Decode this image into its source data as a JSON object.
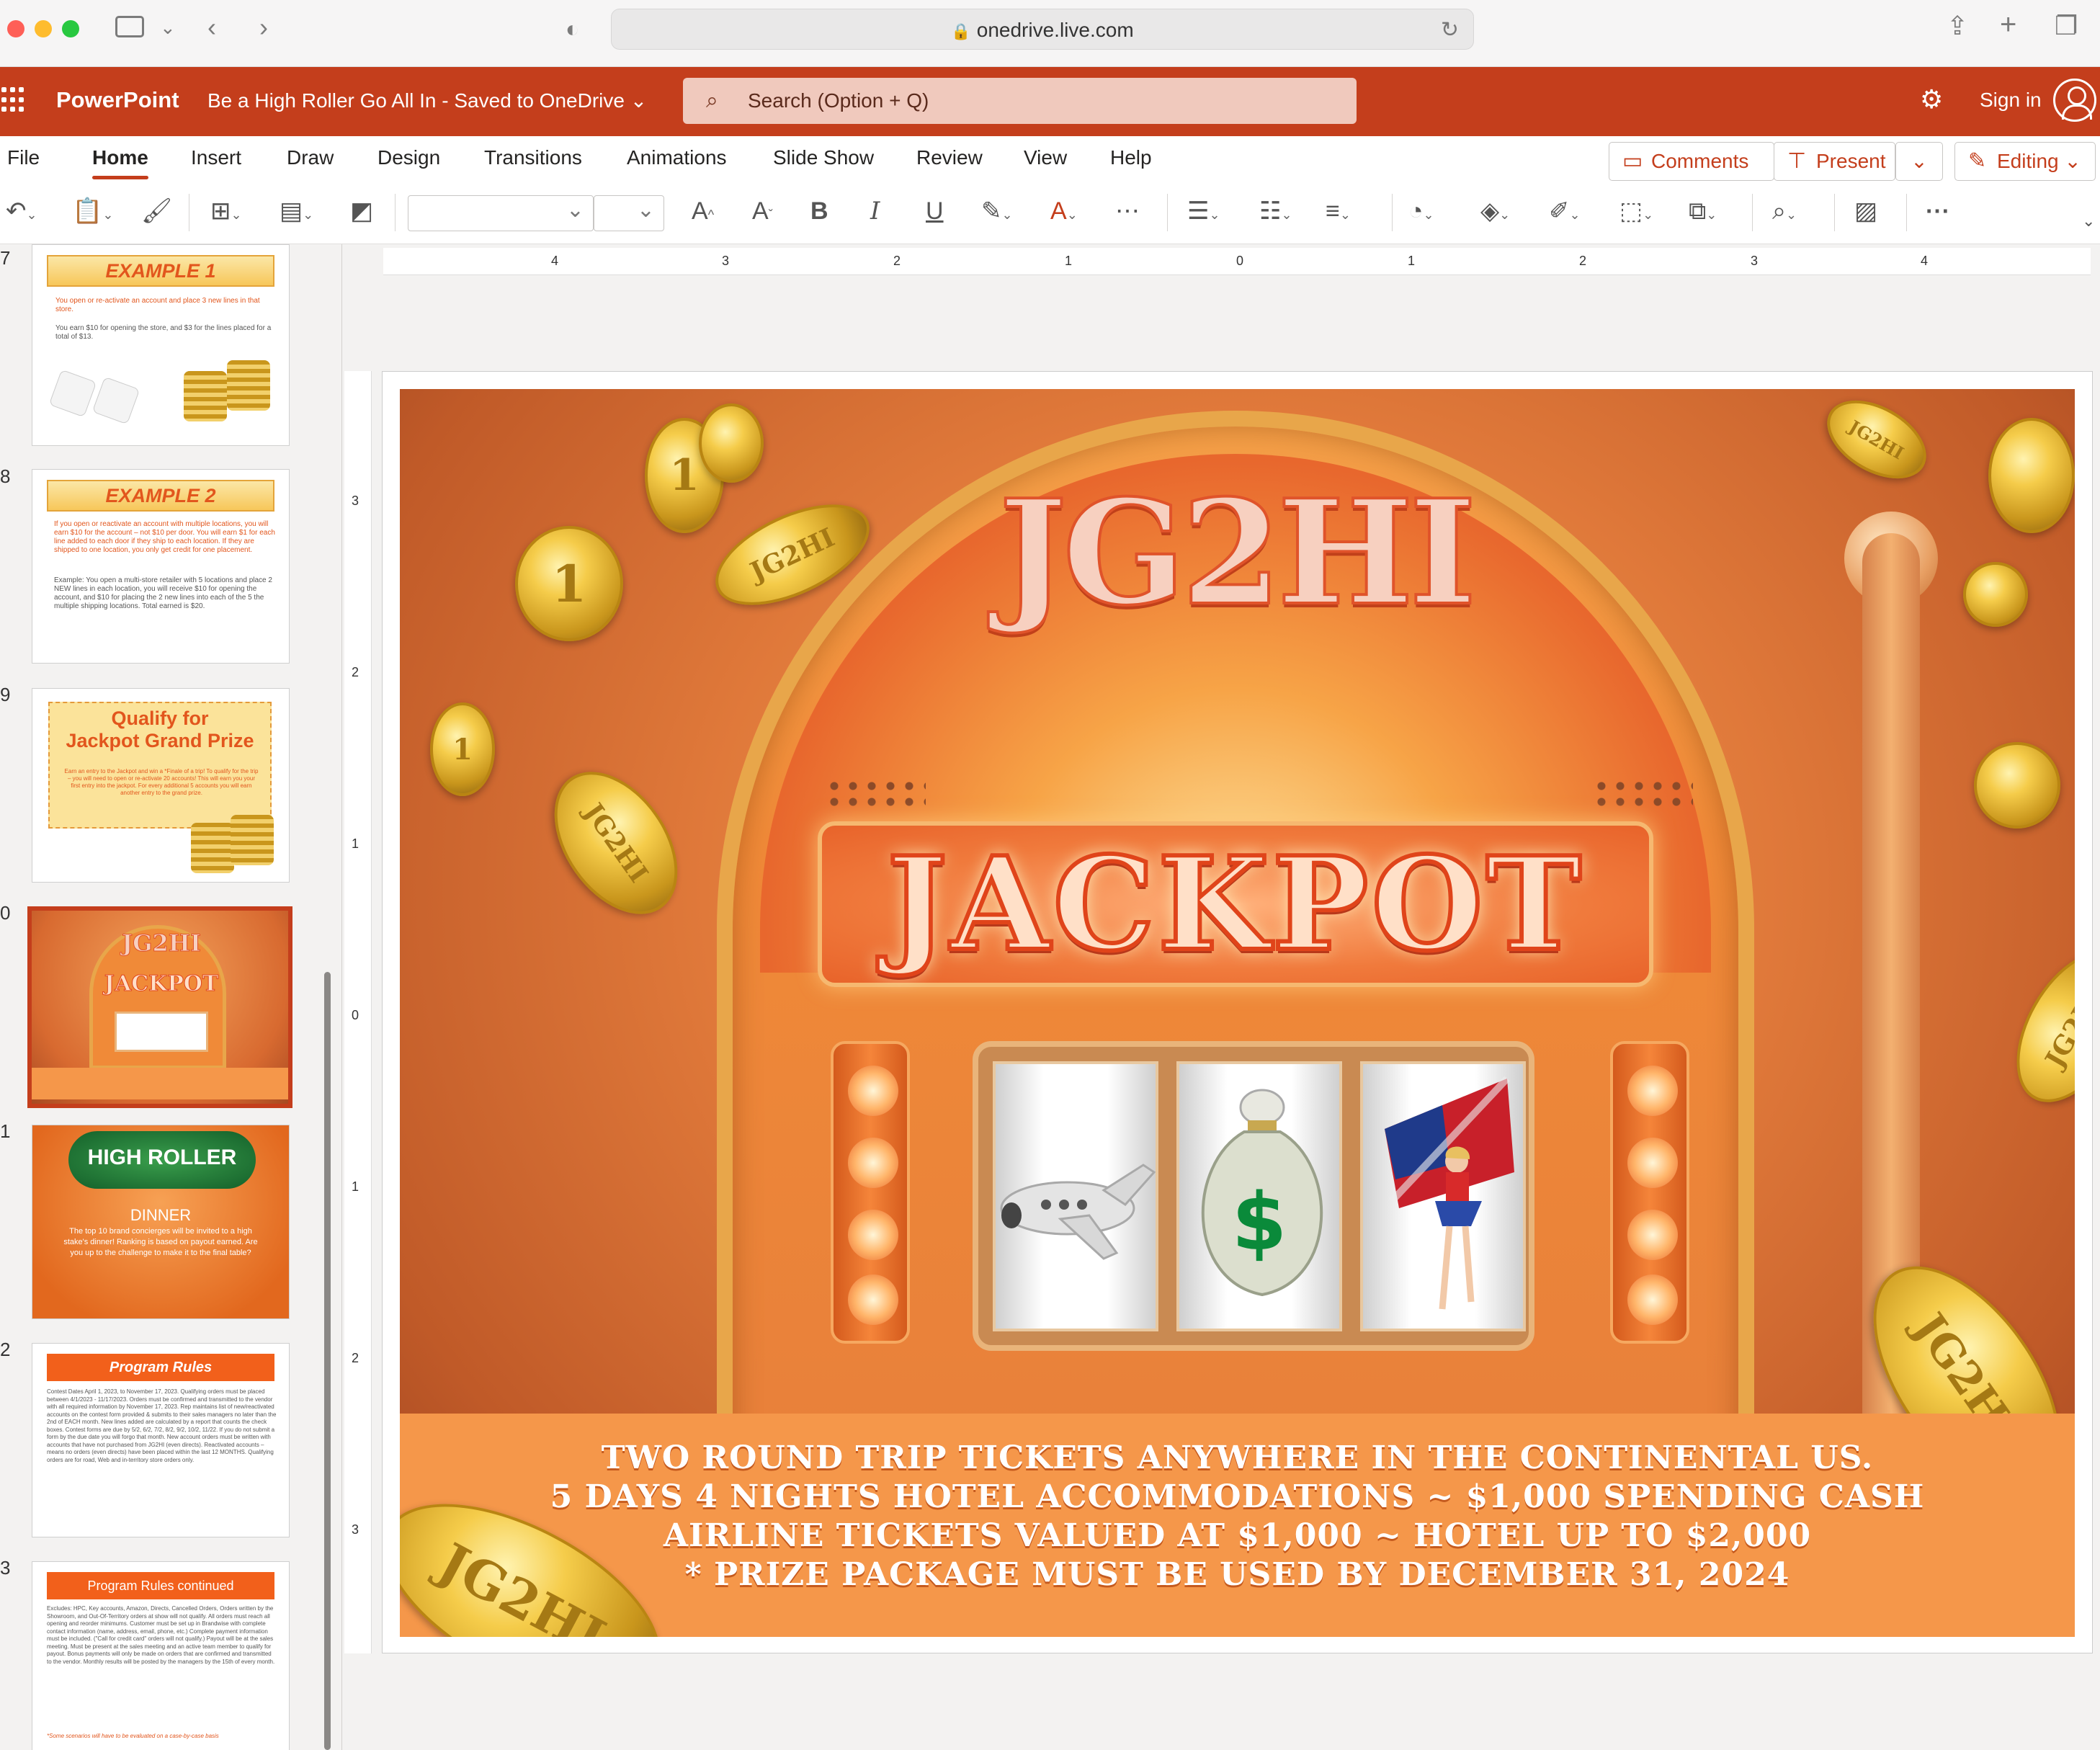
{
  "browser": {
    "url": "onedrive.live.com"
  },
  "app": {
    "name": "PowerPoint",
    "doc_title": "Be a High Roller Go All In  -  Saved to OneDrive ⌄",
    "search_placeholder": "Search (Option + Q)",
    "sign_in": "Sign in"
  },
  "tabs": [
    "File",
    "Home",
    "Insert",
    "Draw",
    "Design",
    "Transitions",
    "Animations",
    "Slide Show",
    "Review",
    "View",
    "Help"
  ],
  "top_buttons": {
    "comments": "Comments",
    "present": "Present",
    "editing": "Editing"
  },
  "ruler": {
    "h": [
      "4",
      "3",
      "2",
      "1",
      "0",
      "1",
      "2",
      "3",
      "4"
    ],
    "v": [
      "3",
      "2",
      "1",
      "0",
      "1",
      "2",
      "3"
    ]
  },
  "thumbnails": [
    {
      "num": "7",
      "title": "EXAMPLE 1",
      "line1": "You open or re-activate an account and place 3 new lines in that store.",
      "line2": "You earn $10 for opening the store, and $3 for the lines placed for a total of $13."
    },
    {
      "num": "8",
      "title": "EXAMPLE 2",
      "line1": "If you open or reactivate an account with multiple locations, you will earn $10 for the account – not $10 per door. You will earn $1 for each line added to each door if they ship to each location. If they are shipped to one location, you only get credit for one placement.",
      "line2": "Example: You open a multi-store retailer with 5 locations and place 2 NEW lines in each location, you will receive $10 for opening the account, and $10 for placing the 2 new lines into each of the 5 the multiple shipping locations. Total earned is $20."
    },
    {
      "num": "9",
      "title1": "Qualify for",
      "title2": "Jackpot Grand Prize",
      "body": "Earn an entry to the Jackpot and win a *Finale of a trip! To qualify for the trip – you will need to open or re-activate 20 accounts! This will earn you your first entry into the jackpot. For every additional 5 accounts you will earn another entry to the grand prize."
    },
    {
      "num": "0",
      "title": "JG2HI",
      "sub": "JACKPOT"
    },
    {
      "num": "1",
      "title": "HIGH ROLLER",
      "sub": "DINNER",
      "body": "The top 10 brand concierges will be invited to a high stake's dinner! Ranking is based on payout earned. Are you up to the challenge to make it to the final table?"
    },
    {
      "num": "2",
      "title": "Program Rules",
      "body": "Contest Dates April 1, 2023, to November 17, 2023. Qualifying orders must be placed between 4/1/2023 - 11/17/2023. Orders must be confirmed and transmitted to the vendor with all required information by November 17, 2023. Rep maintains list of new/reactivated accounts on the contest form provided & submits to their sales managers no later than the 2nd of EACH month. New lines added are calculated by a report that counts the check boxes. Contest forms are due by 5/2, 6/2, 7/2, 8/2, 9/2, 10/2, 11/22. If you do not submit a form by the due date you will forgo that month. New account orders must be written with accounts that have not purchased from JG2HI (even directs). Reactivated accounts – means no orders (even directs) have been placed within the last 12 MONTHS. Qualifying orders are for road, Web and in-territory store orders only."
    },
    {
      "num": "3",
      "title": "Program Rules continued",
      "body": "Excludes: HPC, Key accounts, Amazon, Directs, Cancelled Orders, Orders written by the Showroom, and Out-Of-Territory orders at show will not qualify. All orders must reach all opening and reorder minimums. Customer must be set up in Brandwise with complete contact information (name, address, email, phone, etc.) Complete payment information must be included. (\"Call for credit card\" orders will not qualify.) Payout will be at the sales meeting. Must be present at the sales meeting and an active team member to qualify for payout. Bonus payments will only be made on orders that are confirmed and transmitted to the vendor. Monthly results will be posted by the managers by the 15th of every month.",
      "foot": "*Some scenarios will have to be evaluated on a case-by-case basis"
    }
  ],
  "slide": {
    "logo": "JG2HI",
    "marquee": "JACKPOT",
    "coin_text": "JG2HI",
    "coin_one": "1",
    "reel2_symbol": "$",
    "prize_lines": [
      "TWO ROUND TRIP TICKETS ANYWHERE IN THE CONTINENTAL US.",
      "5 DAYS 4 NIGHTS HOTEL ACCOMMODATIONS ~ $1,000 SPENDING CASH",
      "AIRLINE TICKETS VALUED AT $1,000 ~ HOTEL UP TO $2,000",
      "* PRIZE PACKAGE MUST BE USED BY DECEMBER 31, 2024"
    ]
  },
  "colors": {
    "brand": "#c43e1c",
    "search_bg": "#f0c9bd",
    "slide_orange": "#f5974a"
  }
}
